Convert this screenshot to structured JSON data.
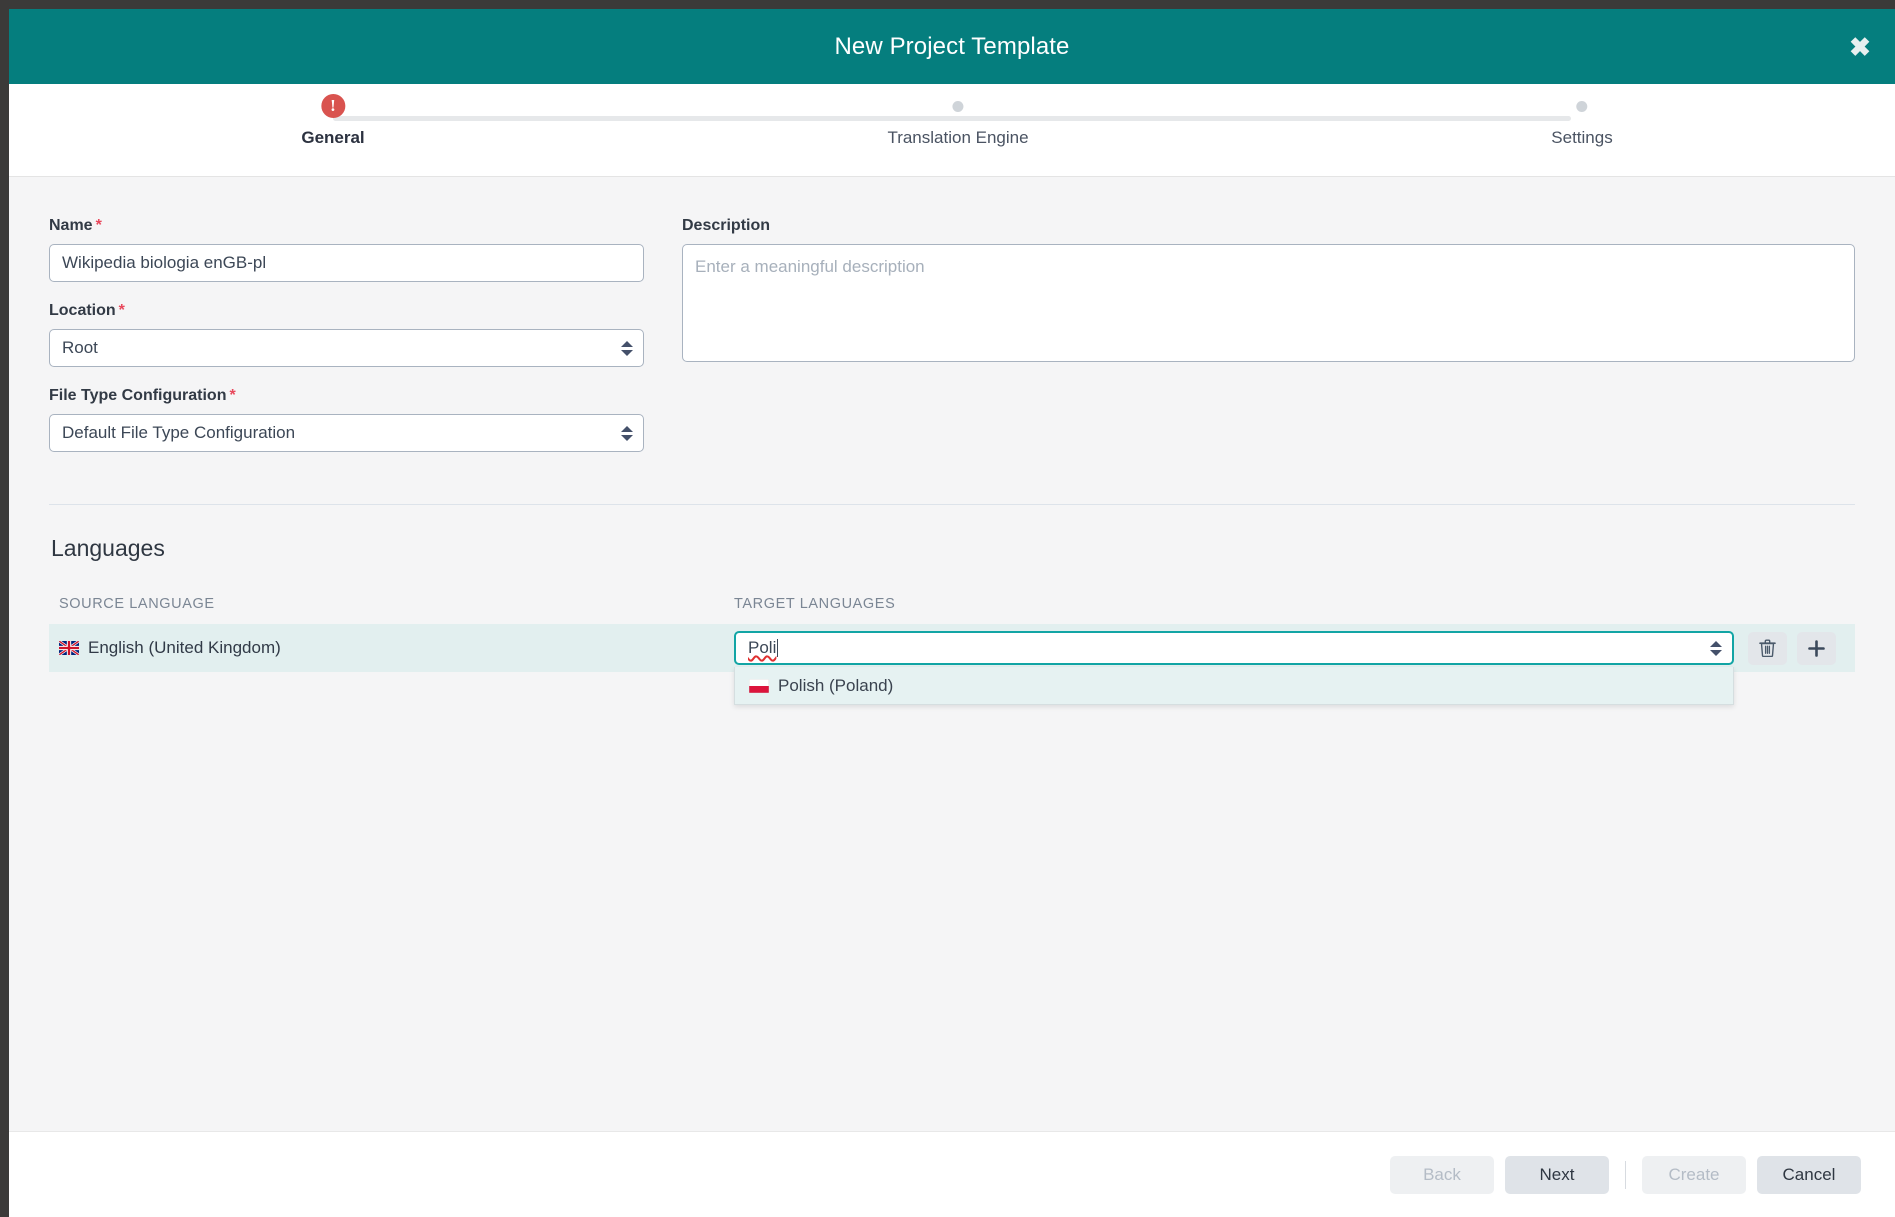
{
  "window": {
    "title": "New Project Template",
    "close_icon": "close-icon"
  },
  "stepper": {
    "steps": [
      {
        "label": "General",
        "state": "error",
        "marker": "error-exclamation-icon",
        "glyph": "!"
      },
      {
        "label": "Translation Engine",
        "state": "pending",
        "marker": "dot-icon",
        "glyph": ""
      },
      {
        "label": "Settings",
        "state": "pending",
        "marker": "dot-icon",
        "glyph": ""
      }
    ]
  },
  "form": {
    "name": {
      "label": "Name",
      "required_marker": "*",
      "value": "Wikipedia biologia enGB-pl"
    },
    "location": {
      "label": "Location",
      "required_marker": "*",
      "value": "Root"
    },
    "file_type_configuration": {
      "label": "File Type Configuration",
      "required_marker": "*",
      "value": "Default File Type Configuration"
    },
    "description": {
      "label": "Description",
      "value": "",
      "placeholder": "Enter a meaningful description"
    }
  },
  "languages": {
    "section_title": "Languages",
    "headers": {
      "source": "SOURCE LANGUAGE",
      "target": "TARGET LANGUAGES"
    },
    "row": {
      "source_language": "English (United Kingdom)",
      "source_flag": "flag-gb-icon",
      "target_input_value": "Poli",
      "delete_icon": "trash-icon",
      "add_icon": "plus-icon"
    },
    "dropdown": {
      "options": [
        {
          "label": "Polish (Poland)",
          "flag": "flag-pl-icon",
          "highlighted": true
        }
      ]
    }
  },
  "footer": {
    "back": {
      "label": "Back",
      "enabled": false
    },
    "next": {
      "label": "Next",
      "enabled": true
    },
    "create": {
      "label": "Create",
      "enabled": false
    },
    "cancel": {
      "label": "Cancel",
      "enabled": true
    }
  },
  "colors": {
    "titlebar_teal": "#057e7e",
    "focus_teal": "#12a5a5",
    "row_highlight": "#e2efef",
    "error_red": "#d9534f",
    "required_red": "#e8485c",
    "body_bg": "#f5f5f6"
  }
}
